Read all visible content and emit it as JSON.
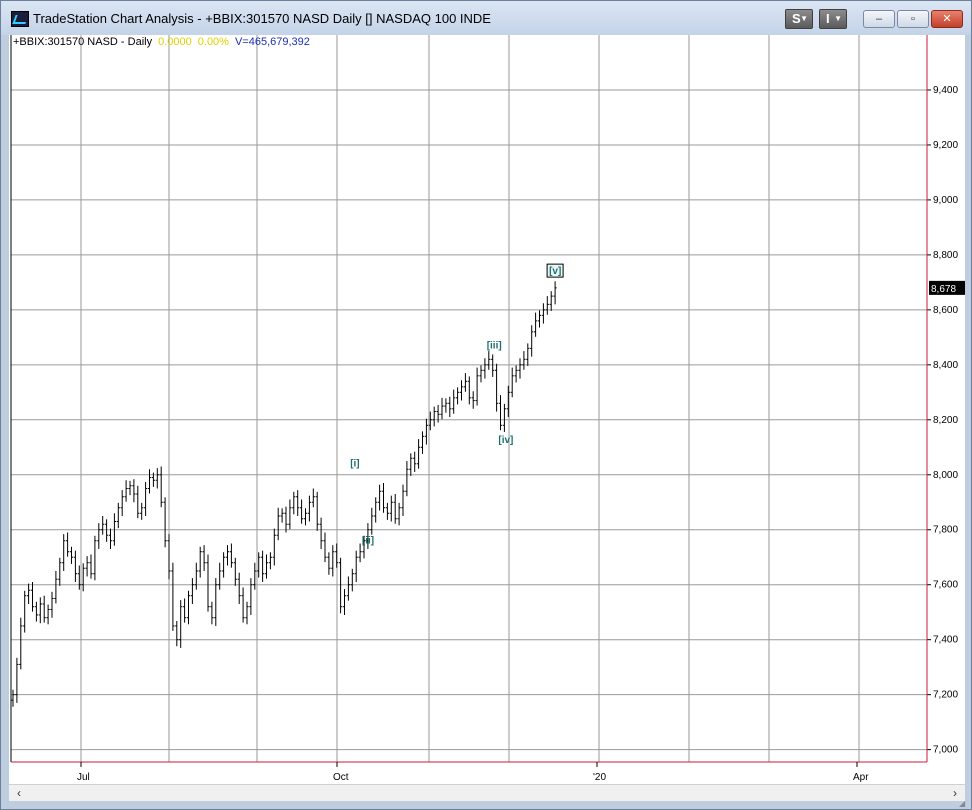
{
  "window": {
    "title": "TradeStation Chart Analysis - +BBIX:301570 NASD Daily [] NASDAQ 100 INDE",
    "s_button": "S",
    "i_button": "I",
    "minimize": "‒",
    "maximize": "▫",
    "close": "✕"
  },
  "info": {
    "symbol": "+BBIX:301570 NASD - Daily",
    "change": "0.0000",
    "percent": "0.00%",
    "volume": "V=465,679,392"
  },
  "colors": {
    "price_axis_line": "#cc1a3a",
    "grid": "#9a9a9a",
    "bars": "#000000",
    "wave_labels": "#1f6f6f",
    "last_price_bg": "#000000"
  },
  "last_price": "8,678",
  "chart_data": {
    "type": "ohlc",
    "price_axis": {
      "ticks": [
        "9,400",
        "9,200",
        "9,000",
        "8,800",
        "8,600",
        "8,400",
        "8,200",
        "8,000",
        "7,800",
        "7,600",
        "7,400",
        "7,200",
        "7,000"
      ],
      "tick_values": [
        9400,
        9200,
        9000,
        8800,
        8600,
        8400,
        8200,
        8000,
        7800,
        7600,
        7400,
        7200,
        7000
      ],
      "range": [
        6955,
        9600
      ]
    },
    "time_axis": {
      "labels": [
        "Jul",
        "Oct",
        "'20",
        "Apr"
      ]
    },
    "wave_labels": [
      {
        "text": "[i]",
        "price": 8030,
        "bar": 88,
        "boxed": false
      },
      {
        "text": "[ii]",
        "price": 7750,
        "bar": 91,
        "boxed": false
      },
      {
        "text": "[iii]",
        "price": 8460,
        "bar": 123,
        "boxed": false
      },
      {
        "text": "[iv]",
        "price": 8115,
        "bar": 126,
        "boxed": false
      },
      {
        "text": "[v]",
        "price": 8730,
        "bar": 139,
        "boxed": true
      }
    ],
    "closes": [
      7200,
      7310,
      7450,
      7560,
      7580,
      7520,
      7490,
      7530,
      7480,
      7510,
      7550,
      7620,
      7680,
      7760,
      7720,
      7700,
      7640,
      7600,
      7660,
      7680,
      7640,
      7760,
      7800,
      7820,
      7780,
      7760,
      7830,
      7880,
      7920,
      7950,
      7960,
      7930,
      7860,
      7880,
      7950,
      7990,
      7980,
      8000,
      7900,
      7760,
      7650,
      7450,
      7400,
      7520,
      7480,
      7560,
      7600,
      7650,
      7720,
      7680,
      7520,
      7480,
      7600,
      7650,
      7700,
      7720,
      7680,
      7620,
      7560,
      7480,
      7520,
      7600,
      7650,
      7700,
      7640,
      7680,
      7700,
      7780,
      7850,
      7860,
      7820,
      7880,
      7920,
      7880,
      7840,
      7860,
      7900,
      7920,
      7820,
      7760,
      7700,
      7660,
      7720,
      7680,
      7520,
      7560,
      7600,
      7640,
      7700,
      7720,
      7760,
      7800,
      7850,
      7900,
      7940,
      7880,
      7860,
      7900,
      7840,
      7880,
      7940,
      8020,
      8060,
      8040,
      8100,
      8140,
      8180,
      8200,
      8230,
      8220,
      8250,
      8260,
      8240,
      8280,
      8300,
      8320,
      8340,
      8280,
      8270,
      8360,
      8380,
      8400,
      8420,
      8380,
      8260,
      8180,
      8240,
      8300,
      8360,
      8380,
      8400,
      8420,
      8460,
      8520,
      8560,
      8580,
      8600,
      8620,
      8650,
      8680
    ]
  }
}
